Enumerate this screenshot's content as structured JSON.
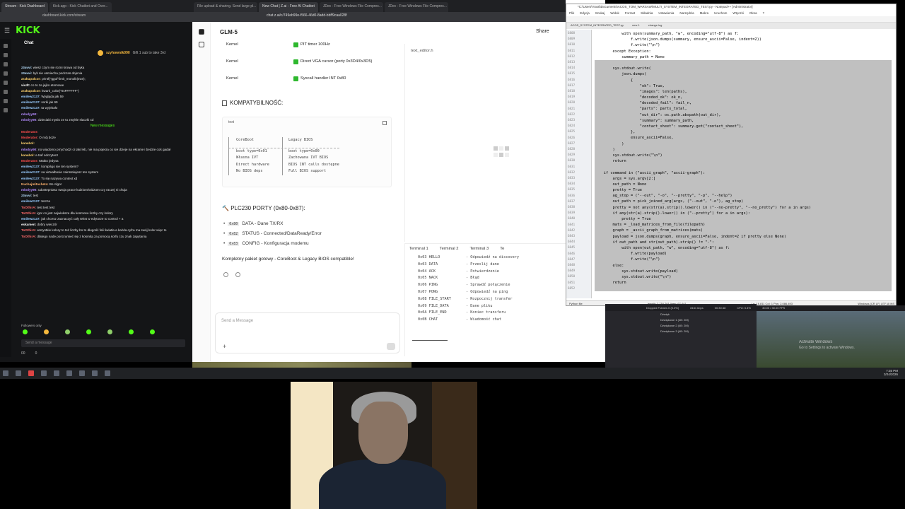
{
  "kick": {
    "tabs": [
      "Stream - Kick Dashboard",
      "Kick.app - Kick Chatbot and Over..."
    ],
    "url": "dashboard.kick.com/stream",
    "logo": "KICK",
    "chat_title": "Chat",
    "pinned_user": "szyhownik090",
    "pinned_text": "Gift 1 sub to take 3rd",
    "messages": [
      {
        "user": "z3avvi:",
        "text": "wiesz czym sie rozni krowa od byka",
        "color": "#b8e0ff"
      },
      {
        "user": "z3avvi:",
        "text": "byk sie usmiecha podczas dojenia",
        "color": "#b8e0ff"
      },
      {
        "user": "arakupulcor:",
        "text": "printf(\"gguf\"limit_monolit(true);",
        "color": "#ffd36e"
      },
      {
        "user": "vicdt:",
        "text": "co to za jajko atomowe",
        "color": "#ffffff"
      },
      {
        "user": "arakupulcor:",
        "text": "kwark_color(\"0xFFFFFF\")",
        "color": "#ffd36e"
      },
      {
        "user": "emilew2137:",
        "text": "Wygląda jak 59",
        "color": "#9cf"
      },
      {
        "user": "emilew2137:",
        "text": "sorki jak 69",
        "color": "#9cf"
      },
      {
        "user": "emilew2137:",
        "text": "ta wyjebało",
        "color": "#9cf"
      },
      {
        "user": "mlodyy90:",
        "text": "",
        "color": "#b58cff"
      },
      {
        "user": "mlodyy90:",
        "text": "dzieciaki myslo ze to zwykle slaczki xd",
        "color": "#b58cff"
      }
    ],
    "new_messages_label": "New messages",
    "messages2": [
      {
        "user": "Moderator:",
        "text": "",
        "color": "#ff4d4d"
      },
      {
        "user": "Moderator:",
        "text": "O mój boże",
        "color": "#ff4d4d"
      },
      {
        "user": "kanabol:",
        "text": "",
        "color": "#ffd36e"
      },
      {
        "user": "mlodyy90:",
        "text": "no wiadomo prrychodzi ci taki leb, nie ma pojecia co sie dzieje na ekranie i bedzie coś gadał",
        "color": "#b58cff"
      },
      {
        "user": "kanabol:",
        "text": "a traf odczytacz",
        "color": "#ffd36e"
      },
      {
        "user": "Moderator:",
        "text": "Matko jedyna",
        "color": "#ff4d4d"
      },
      {
        "user": "emilew2137:",
        "text": "kompilujo sie ten system?",
        "color": "#9cf"
      },
      {
        "user": "emilew2137:",
        "text": "na virtualboxie zainstalujesz ten system",
        "color": "#9cf"
      },
      {
        "user": "emilew2137:",
        "text": "To się nazywa context xd",
        "color": "#9cf"
      },
      {
        "user": "Nuchajmitocheta:",
        "text": "Bo Algor",
        "color": "#ffb36e"
      },
      {
        "user": "mlodyy90:",
        "text": "udostepniasz swoja prace ludziom/widzom czy raczej ni chuja",
        "color": "#b58cff"
      },
      {
        "user": "z3avvi:",
        "text": "test",
        "color": "#b8e0ff"
      },
      {
        "user": "emilew2137:",
        "text": "test ta",
        "color": "#9cf"
      },
      {
        "user": "ToOthirA:",
        "text": "test test test",
        "color": "#ff6b6b"
      },
      {
        "user": "ToOthirA:",
        "text": "igor co jest najwieksze dla kosmosu liczby czy kolory",
        "color": "#ff6b6b"
      },
      {
        "user": "emilew2137:",
        "text": "jak chcesz zaznaczyć cały tekst w edytorze to control + a",
        "color": "#9cf"
      },
      {
        "user": "eskamen:",
        "text": "dobry wieczór",
        "color": "#ffffff"
      },
      {
        "user": "ToOthirA:",
        "text": "wszystkie kolory to też liczby bo to długość fali światła a każda cyfra ma swój kolor więc to",
        "color": "#ff6b6b"
      },
      {
        "user": "ToOthirA:",
        "text": "dlatego nade porozumieć się z kosmitą za pomocą sorfu czu znak zapytania",
        "color": "#ff6b6b"
      }
    ],
    "followers_only": "Followers only",
    "send_placeholder": "Send a message",
    "footer_viewers": "00",
    "footer_count": "0"
  },
  "zai": {
    "tabs": [
      "File upload & sharing. Send large pl...",
      "New Chat | Z.ai - Free AI Chatbot",
      "JDec - Free Windows File Compres...",
      "JDec - Free Windows File Compres..."
    ],
    "url": "chat.z.ai/c/749eb99e-f566-46d0-8add-bbff9caa028f",
    "model": "GLM-5",
    "share": "Share",
    "kernel_rows": [
      {
        "label": "Kernel",
        "value": "PIT timer 100Hz"
      },
      {
        "label": "Kernel",
        "value": "Direct VGA cursor (porty 0x3D4/0x3D5)"
      },
      {
        "label": "Kernel",
        "value": "Syscall handler INT 0x80"
      }
    ],
    "compat_title": "KOMPATYBILNOŚĆ:",
    "code_lang": "text",
    "compat_table": [
      [
        "CoreBoot",
        "Legacy BIOS"
      ],
      [
        "",
        ""
      ],
      [
        "boot type=0x01",
        "boot type=0x00"
      ],
      [
        "Własna IVT",
        "Zachowana IVT BIOS"
      ],
      [
        "Direct hardware",
        "BIOS INT calls dostępne"
      ],
      [
        "No BIOS deps",
        "Full BIOS support"
      ]
    ],
    "plc_title": "PLC230 PORTY (0x80-0x87):",
    "plc_rows": [
      {
        "code": "0x80",
        "text": "DATA - Dane TX/RX"
      },
      {
        "code": "0x82",
        "text": "STATUS - Connected/DataReady/Error"
      },
      {
        "code": "0x83",
        "text": "CONFIG - Konfiguracja modemu"
      }
    ],
    "summary": "Kompletny pakiet gotowy - CoreBoot & Legacy BIOS compatible!",
    "input_placeholder": "Send a Message",
    "editor_tab": "text_editor.h",
    "terminal_tabs": [
      "Terminal 1",
      "Terminal 2",
      "Terminal 3",
      "Te"
    ],
    "terminal_lines": [
      [
        "0x03 HELLO",
        "- Odpowiedź na discovery"
      ],
      [
        "0x03 DATA",
        "- Przeslij dane"
      ],
      [
        "0x04 ACK",
        "- Potwierdzenie"
      ],
      [
        "0x05 NACK",
        "- Błąd"
      ],
      [
        "0x06 PING",
        "- Sprawdź połączenie"
      ],
      [
        "0x07 PONG",
        "- Odpowiedź na ping"
      ],
      [
        "0x08 FILE_START",
        "- Rozpocznij transfer"
      ],
      [
        "0x09 FILE_DATA",
        "- Dane pliku"
      ],
      [
        "0x0A FILE_END",
        "- Koniec transferu"
      ],
      [
        "0x0B CHAT",
        "- Wiadomość chat"
      ]
    ]
  },
  "notepad": {
    "title": "*C:\\Users\\Yuval\\Documents\\ACOS_TOM_WARSAW\\MULTI_SYSTEM_INTEGRATED_TEST.py - Notepad++ [Administrator]",
    "menu": [
      "Plik",
      "Edycja",
      "Szukaj",
      "Widok",
      "Format",
      "Składnia",
      "Ustawienia",
      "Narzędzia",
      "Makra",
      "Uruchom",
      "Wtyczki",
      "Okna",
      "?"
    ],
    "file_tabs": [
      "ACOS_SYSTEM_INTEGRATED_TEST.py",
      "new 1",
      "change.log"
    ],
    "gutter_start": 6808,
    "lines": [
      "            with open(summary_path, \"w\", encoding=\"utf-8\") as f:",
      "                f.write(json.dumps(summary, ensure_ascii=False, indent=2))",
      "                f.write(\"\\n\")",
      "        except Exception:",
      "            summary_path = None",
      "",
      "        sys.stdout.write(",
      "            json.dumps(",
      "                {",
      "                    \"ok\": True,",
      "                    \"images\": len(paths),",
      "                    \"decoded_ok\": ok_n,",
      "                    \"decoded_fail\": fail_n,",
      "                    \"parts\": parts_total,",
      "                    \"out_dir\": os.path.abspath(out_dir),",
      "                    \"summary\": summary_path,",
      "                    \"contact_sheet\": summary.get(\"contact_sheet\"),",
      "                },",
      "                ensure_ascii=False,",
      "            )",
      "        )",
      "        sys.stdout.write(\"\\n\")",
      "        return",
      "",
      "    if command in (\"ascii_graph\", \"ascii-graph\"):",
      "        args = sys.argv[2:]",
      "        out_path = None",
      "        pretty = True",
      "        ag_stop = (\"--out\", \"-o\", \"--pretty\", \"-p\", \"--help\")",
      "        out_path = pick_joined_arg(args, (\"--out\", \"-o\"), ag_stop)",
      "        pretty = not any(str(a).strip().lower() in (\"--no-pretty\", \"--no_pretty\") for a in args)",
      "        if any(str(a).strip().lower() in (\"--pretty\") for a in args):",
      "            pretty = True",
      "        mats = _load_matrices_from_file(filepath)",
      "        graph = _ascii_graph_from_matrices(mats)",
      "        payload = json.dumps(graph, ensure_ascii=False, indent=2 if pretty else None)",
      "        if out_path and str(out_path).strip() != \"-\":",
      "            with open(out_path, \"w\", encoding=\"utf-8\") as f:",
      "                f.write(payload)",
      "                f.write(\"\\n\")",
      "        else:",
      "            sys.stdout.write(payload)",
      "            sys.stdout.write(\"\\n\")",
      "        return",
      ""
    ],
    "status_left": "Python file",
    "status_mid": "length: 2,716,761   lines: 67,441",
    "status_pos": "Ln: 16,811   Col: 1   Pos: 2,086,493",
    "status_right": "Windows (CR LF)   UTF-8   INS"
  },
  "obs": {
    "stats": [
      "Dropped Frames 0 (0.0%)",
      "8161 kbps",
      "00:30:48",
      "CPU: 0.4%",
      "30.00 / 30.00 FPS"
    ],
    "rows": [
      "Dźwięk",
      "Dźwiękowe 1 (4B: 2M)",
      "Dźwiękowe 2 (4B: 2M)",
      "Dźwiękowe 3 (4B: 2M)"
    ],
    "activate_title": "Activate Windows",
    "activate_sub": "Go to Settings to activate Windows."
  },
  "clock": {
    "time": "7:35 PM",
    "date": "3/24/2026"
  }
}
